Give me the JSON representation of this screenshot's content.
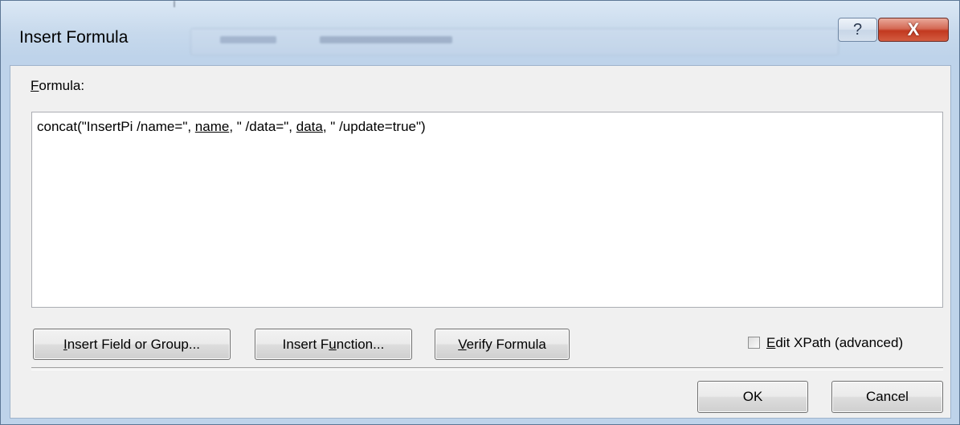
{
  "window": {
    "title": "Insert Formula",
    "help_glyph": "?",
    "close_glyph": "X"
  },
  "formula": {
    "label_mnemonic": "F",
    "label_rest": "ormula:",
    "parts": {
      "p1": "concat(\"InsertPi /name=\", ",
      "field1": "name",
      "p2": ", \" /data=\", ",
      "field2": "data",
      "p3": ", \" /update=true\")"
    }
  },
  "buttons": {
    "insert_field": {
      "mnemonic": "I",
      "rest": "nsert Field or Group..."
    },
    "insert_function": {
      "pre": "Insert F",
      "mnemonic": "u",
      "rest": "nction..."
    },
    "verify": {
      "mnemonic": "V",
      "rest": "erify Formula"
    },
    "ok": "OK",
    "cancel": "Cancel"
  },
  "checkbox": {
    "mnemonic": "E",
    "rest": "dit XPath (advanced)",
    "checked": false
  }
}
